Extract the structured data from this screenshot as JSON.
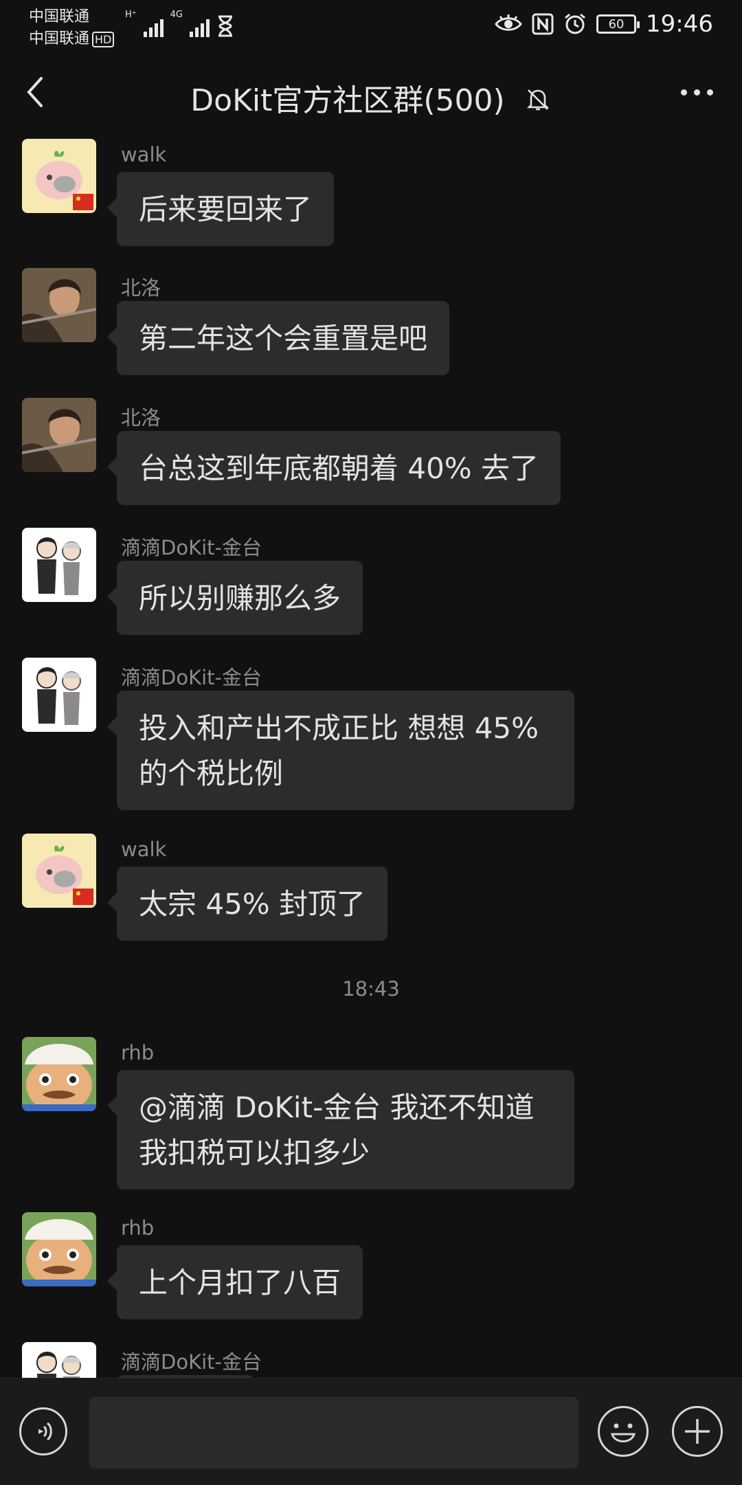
{
  "status_bar": {
    "carrier_1": "中国联通",
    "carrier_2": "中国联通",
    "hd_badge": "HD",
    "net_type_1": "H⁺",
    "net_type_2": "4G",
    "battery_level": "60",
    "time": "19:46"
  },
  "header": {
    "title": "DoKit官方社区群(500)"
  },
  "messages": [
    {
      "sender": "walk",
      "text": "后来要回来了"
    },
    {
      "sender": "北洛",
      "text": "第二年这个会重置是吧"
    },
    {
      "sender": "北洛",
      "text": "台总这到年底都朝着 40% 去了"
    },
    {
      "sender": "滴滴DoKit-金台",
      "text": "所以别赚那么多"
    },
    {
      "sender": "滴滴DoKit-金台",
      "text": "投入和产出不成正比 想想 45% 的个税比例"
    },
    {
      "sender": "walk",
      "text": "太宗 45% 封顶了"
    },
    {
      "sender": "rhb",
      "text": "@滴滴 DoKit-金台  我还不知道我扣税可以扣多少"
    },
    {
      "sender": "rhb",
      "text": "上个月扣了八百"
    },
    {
      "sender": "滴滴DoKit-金台",
      "text": ""
    }
  ],
  "timestamp": "18:43",
  "input": {
    "value": "",
    "placeholder": ""
  },
  "colors": {
    "background": "#111111",
    "bubble": "#2c2c2c",
    "input_bar": "#1b1b1b"
  }
}
